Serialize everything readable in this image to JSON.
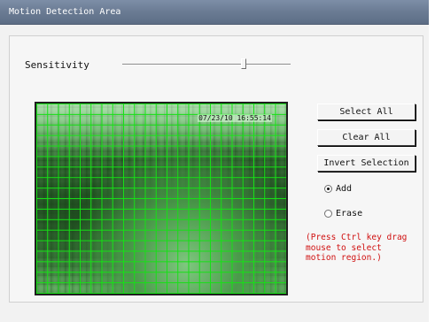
{
  "window": {
    "title": "Motion Detection Area"
  },
  "sensitivity": {
    "label": "Sensitivity",
    "value_fraction": 0.72
  },
  "video": {
    "timestamp": "07/23/10 16:55:14"
  },
  "buttons": {
    "select_all": "Select All",
    "clear_all": "Clear All",
    "invert_selection": "Invert Selection"
  },
  "mode": {
    "options": [
      {
        "label": "Add",
        "selected": true
      },
      {
        "label": "Erase",
        "selected": false
      }
    ]
  },
  "hint": {
    "lines": [
      "(Press Ctrl key drag",
      "mouse to select",
      "motion region.)"
    ]
  },
  "colors": {
    "grid_line": "#16e016",
    "hint_text": "#d01010",
    "titlebar": "#6a7b93"
  }
}
